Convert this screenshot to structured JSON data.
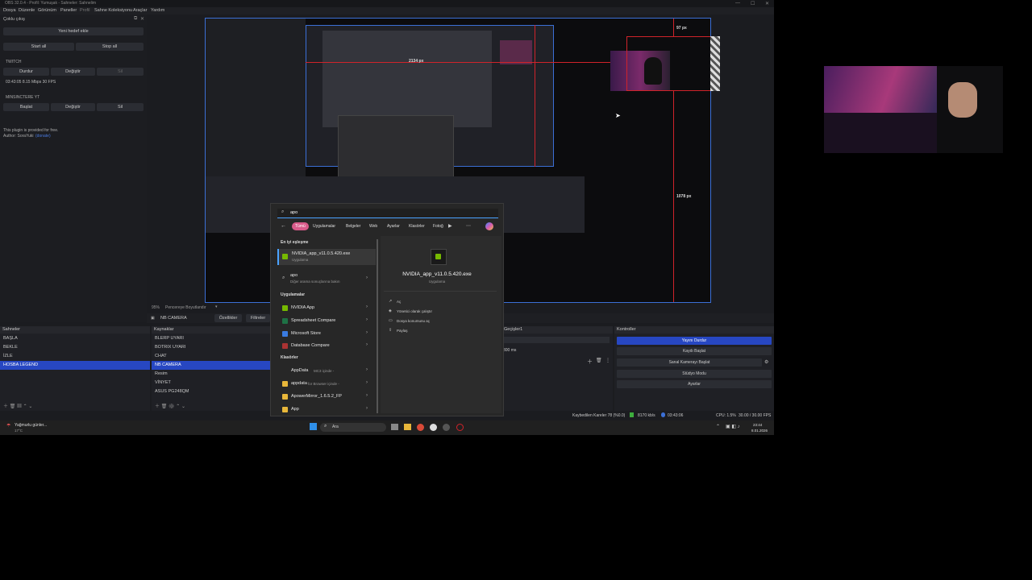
{
  "window": {
    "title": "OBS 32.0.4 - Profil: Yumuşak - Sahneler: Sahnelim",
    "controls": [
      "—",
      "☐",
      "✕"
    ]
  },
  "menu": [
    "Dosya",
    "Düzenle",
    "Görünüm",
    "Paneller",
    "Profil",
    "Sahne Koleksiyonu",
    "Araçlar",
    "Yardım"
  ],
  "multistream": {
    "dock_title": "Çoklu çıkış",
    "add_target": "Yeni hedef ekle",
    "start_all": "Start all",
    "stop_all": "Stop all",
    "targets": [
      {
        "name": "TWITCH",
        "stop": "Durdur",
        "edit": "Değiştir",
        "delete": "Sil",
        "stats": "03:43:05  8.15 Mbps  30 FPS"
      },
      {
        "name": "MINSINCTERE YT",
        "start": "Başlat",
        "edit": "Değiştir",
        "delete": "Sil"
      }
    ],
    "footer1": "This plugin is provided for free.",
    "footer2": "Author: SoraYuki",
    "footer_link": "(donate)"
  },
  "preview": {
    "measurements": {
      "width_top": "97 px",
      "height_right": "1078 px",
      "width_main": "2134 px"
    }
  },
  "zoom_bar": {
    "zoom": "95%",
    "label": "Pencereye Boyutlandır"
  },
  "source_toolbar": {
    "source": "NB CAMERA",
    "properties": "Özellikler",
    "filters": "Filtreler"
  },
  "scenes": {
    "title": "Sahneler",
    "items": [
      "BAŞLA",
      "BEKLE",
      "İZLE",
      "HOSBA LEGEND"
    ],
    "selected": 3
  },
  "sources": {
    "title": "Kaynaklar",
    "items": [
      "BLERP UYARI",
      "BOTRIX UYARI",
      "CHAT",
      "NB CAMERA",
      "Resim",
      "VİNYET",
      "ASUS PG248QM"
    ],
    "selected": 3
  },
  "transitions": {
    "title": "Geçişler1",
    "duration": "300 ms"
  },
  "controls": {
    "title": "Kontroller",
    "buttons": [
      "Yayını Durdur",
      "Kaydı Başlat",
      "Sanal Kamerayı Başlat",
      "Stüdyo Modu",
      "Ayarlar"
    ]
  },
  "status": {
    "dropped": "Kaybedilen Kareler 78 (%0.0)",
    "bitrate": "8170 kb/s",
    "time": "03:43:06",
    "cpu": "CPU: 1.5%",
    "fps": "30.00 / 30.00 FPS"
  },
  "taskbar": {
    "weather": "Yağmurlu günler...",
    "temp": "17°C",
    "search": "Ara",
    "clock": "23:44",
    "date": "8.01.2026"
  },
  "search_popup": {
    "query": "apo",
    "tabs": [
      "Tümü",
      "Uygulamalar",
      "Belgeler",
      "Web",
      "Ayarlar",
      "Klasörler",
      "Fotoğ"
    ],
    "best_match_header": "En iyi eşleşme",
    "best_match": {
      "name": "NVIDIA_app_v11.0.5.420.exe",
      "sub": "Uygulama"
    },
    "web_item": {
      "name": "apo",
      "sub": "Diğer arama sonuçlarına bakın"
    },
    "apps_header": "Uygulamalar",
    "apps": [
      "NVIDIA App",
      "Spreadsheet Compare",
      "Microsoft Store",
      "Database Compare"
    ],
    "folders_header": "Klasörler",
    "folders": [
      {
        "name": "AppData",
        "sub": "MC3 içinde -"
      },
      {
        "name": "appdata",
        "sub": "for Browser içinde -"
      },
      {
        "name": "ApowerMirror_1.6.5.2_FP",
        "sub": ""
      },
      {
        "name": "App",
        "sub": ""
      }
    ],
    "detail": {
      "name": "NVIDIA_app_v11.0.5.420.exe",
      "sub": "Uygulama",
      "actions": [
        "Aç",
        "Yönetici olarak çalıştır",
        "Dosya konumunu aç",
        "Paylaş"
      ]
    }
  },
  "colors": {
    "accent": "#2747c2",
    "guide": "#d0232a",
    "nvidia": "#76b900"
  }
}
